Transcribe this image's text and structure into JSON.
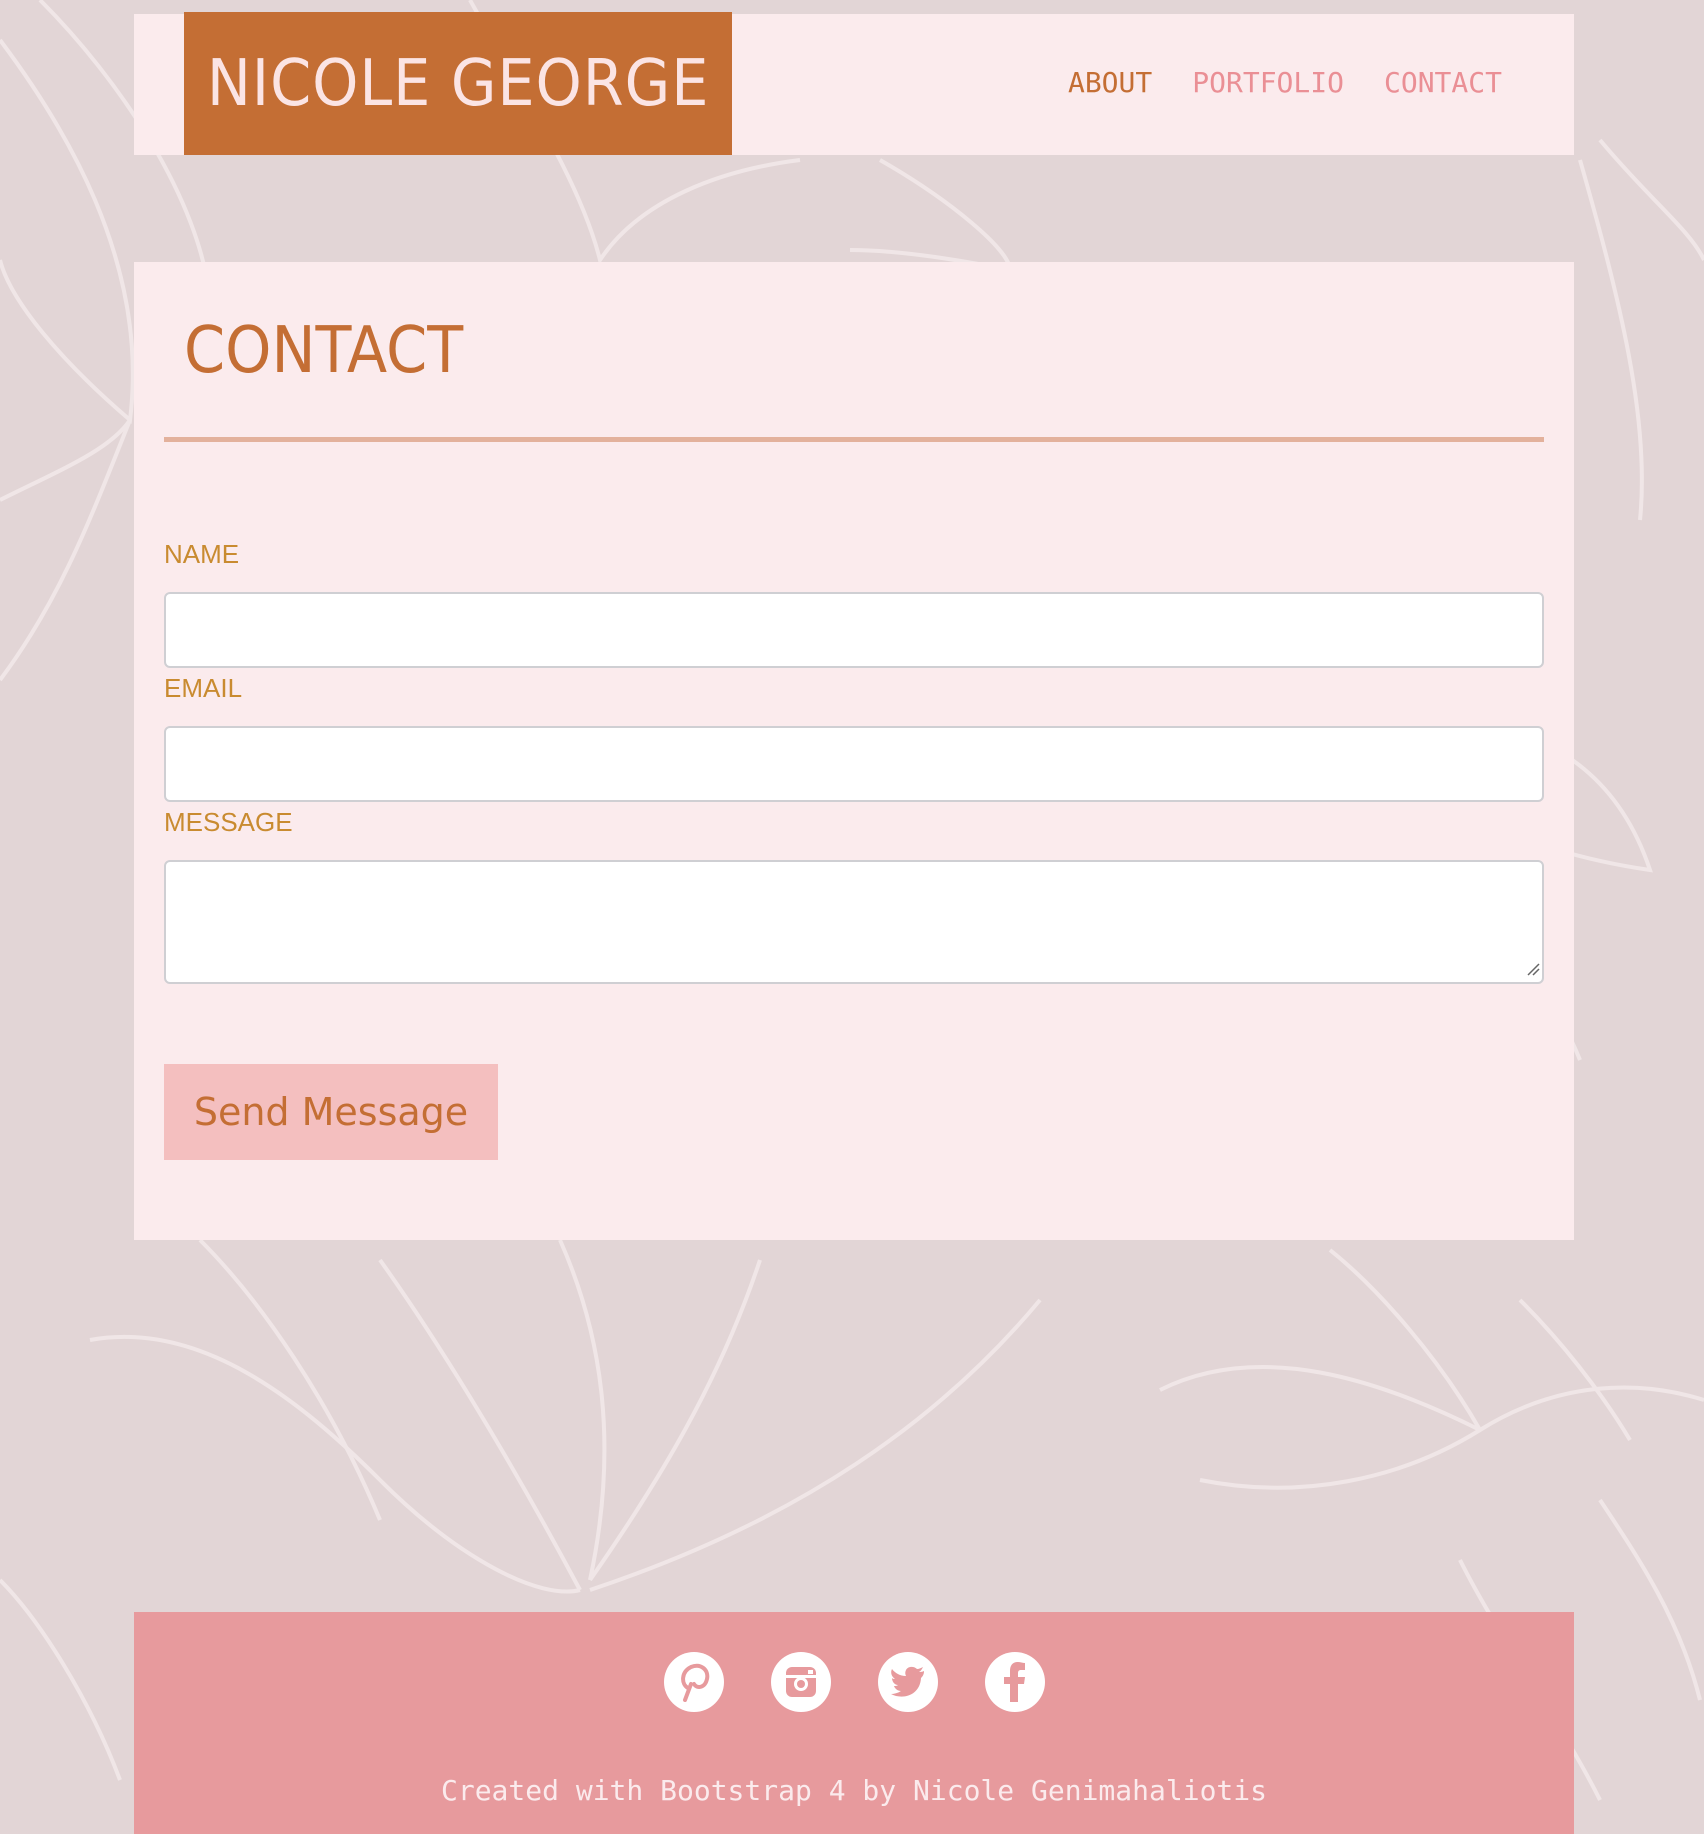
{
  "header": {
    "brand": "NICOLE GEORGE",
    "nav": [
      {
        "label": "ABOUT",
        "active": true
      },
      {
        "label": "PORTFOLIO",
        "active": false
      },
      {
        "label": "CONTACT",
        "active": false
      }
    ]
  },
  "contact": {
    "title": "CONTACT",
    "fields": {
      "name_label": "NAME",
      "name_value": "",
      "email_label": "EMAIL",
      "email_value": "",
      "message_label": "MESSAGE",
      "message_value": ""
    },
    "submit_label": "Send Message"
  },
  "footer": {
    "socials": [
      "pinterest-icon",
      "instagram-icon",
      "twitter-icon",
      "facebook-icon"
    ],
    "credit": "Created with Bootstrap 4 by Nicole Genimahaliotis"
  },
  "colors": {
    "background": "#e2d5d6",
    "panel": "#fbebed",
    "brand": "#c46e34",
    "label": "#c98b30",
    "nav_inactive": "#ea8f95",
    "button": "#f4bfbf",
    "footer": "#e79a9d"
  }
}
